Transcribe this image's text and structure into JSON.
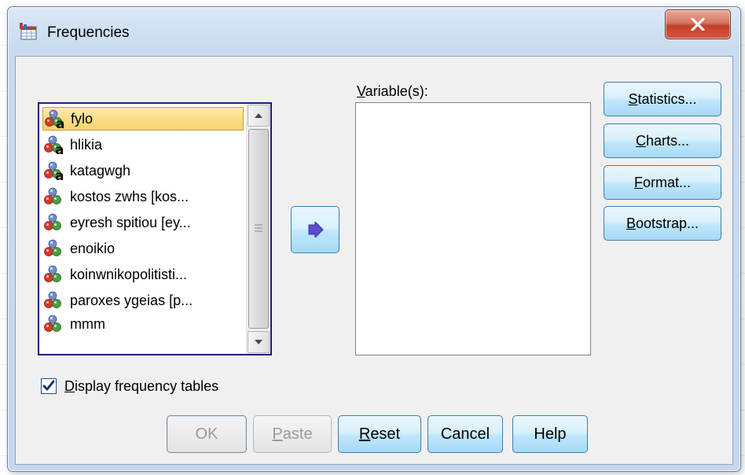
{
  "window": {
    "title": "Frequencies",
    "close_glyph": "X"
  },
  "variable_list": {
    "items": [
      {
        "label": "fylo",
        "icon": "nominal-string-icon",
        "selected": true
      },
      {
        "label": "hlikia",
        "icon": "nominal-string-icon",
        "selected": false
      },
      {
        "label": "katagwgh",
        "icon": "nominal-string-icon",
        "selected": false
      },
      {
        "label": "kostos zwhs [kos...",
        "icon": "nominal-icon",
        "selected": false
      },
      {
        "label": "eyresh spitiou [ey...",
        "icon": "nominal-icon",
        "selected": false
      },
      {
        "label": "enoikio",
        "icon": "nominal-icon",
        "selected": false
      },
      {
        "label": "koinwnikopolitisti...",
        "icon": "nominal-icon",
        "selected": false
      },
      {
        "label": "paroxes ygeias [p...",
        "icon": "nominal-icon",
        "selected": false
      },
      {
        "label": "mmm",
        "icon": "nominal-icon",
        "selected": false
      }
    ]
  },
  "target_list": {
    "label_first": "V",
    "label_rest": "ariable(s):"
  },
  "side_buttons": [
    {
      "name": "statistics-button",
      "mnemonic": "S",
      "rest": "tatistics...",
      "pre": ""
    },
    {
      "name": "charts-button",
      "mnemonic": "C",
      "rest": "harts...",
      "pre": ""
    },
    {
      "name": "format-button",
      "mnemonic": "F",
      "rest": "ormat...",
      "pre": ""
    },
    {
      "name": "bootstrap-button",
      "mnemonic": "B",
      "rest": "ootstrap...",
      "pre": ""
    }
  ],
  "checkbox": {
    "mnemonic": "D",
    "rest": "isplay frequency tables",
    "checked": true
  },
  "bottom_buttons": {
    "ok": {
      "label": "OK",
      "enabled": false
    },
    "paste": {
      "mnemonic": "P",
      "rest": "aste",
      "enabled": false
    },
    "reset": {
      "mnemonic": "R",
      "rest": "eset",
      "enabled": true
    },
    "cancel": {
      "label": "Cancel",
      "enabled": true
    },
    "help": {
      "label": "Help",
      "enabled": true
    }
  },
  "colors": {
    "selection": "#f7d36d",
    "button_border": "#3c7fb1",
    "close_red": "#c2402a"
  }
}
